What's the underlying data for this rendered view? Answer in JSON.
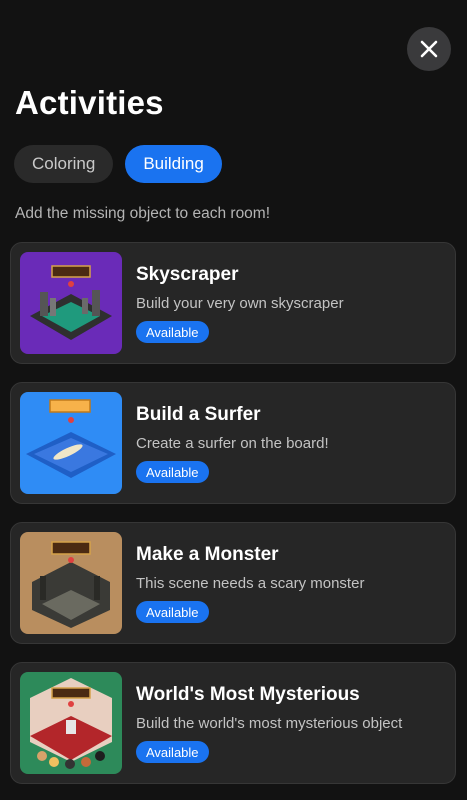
{
  "header": {
    "title": "Activities",
    "close_icon": "close-icon"
  },
  "tabs": [
    {
      "label": "Coloring",
      "active": false
    },
    {
      "label": "Building",
      "active": true
    }
  ],
  "instruction": "Add the missing object to each room!",
  "colors": {
    "accent": "#1a73f0",
    "background": "#121212",
    "card": "#262626"
  },
  "activities": [
    {
      "title": "Skyscraper",
      "description": "Build your very own skyscraper",
      "badge": "Available",
      "thumbnail": "skyscraper-scene"
    },
    {
      "title": "Build a Surfer",
      "description": "Create a surfer on the board!",
      "badge": "Available",
      "thumbnail": "surfer-scene"
    },
    {
      "title": "Make a Monster",
      "description": "This scene needs a scary monster",
      "badge": "Available",
      "thumbnail": "monster-scene"
    },
    {
      "title": "World's Most Mysterious",
      "description": "Build the world's most mysterious object",
      "badge": "Available",
      "thumbnail": "mysterious-scene"
    }
  ]
}
